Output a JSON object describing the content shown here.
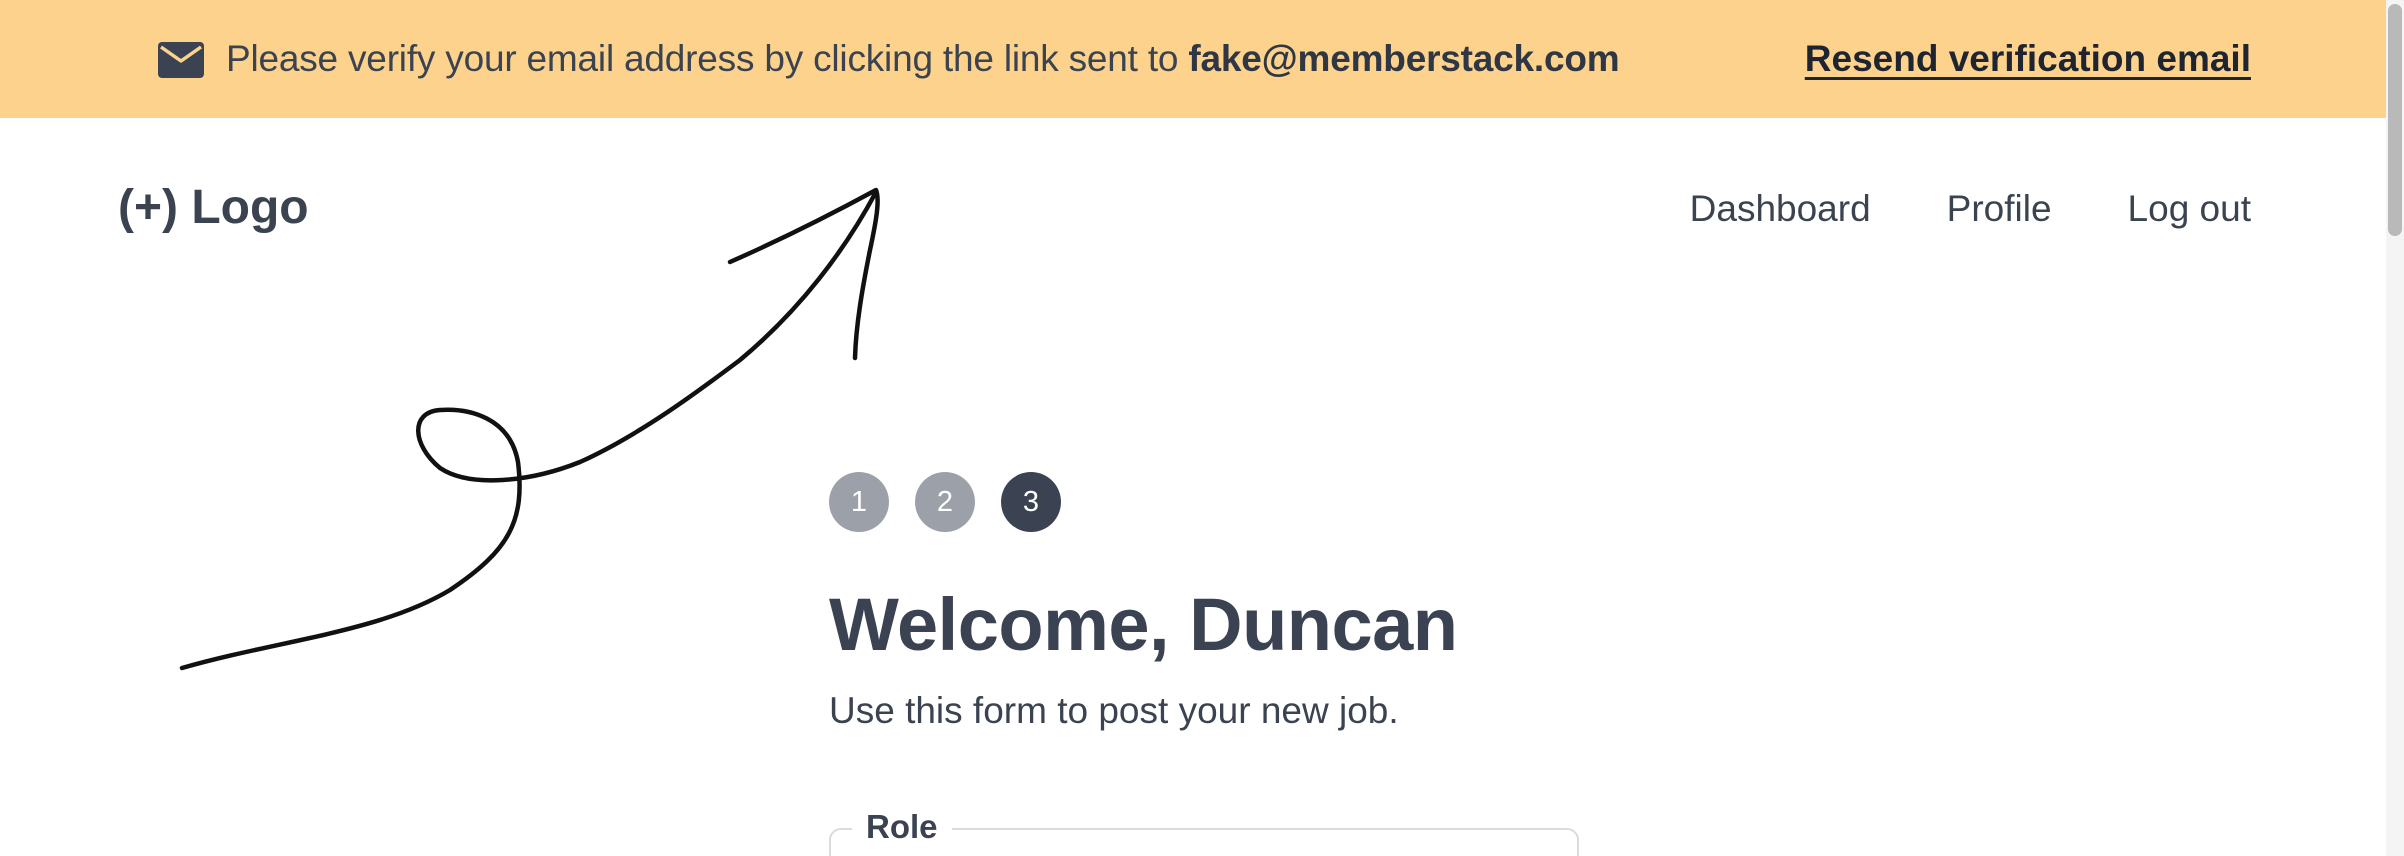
{
  "banner": {
    "icon": "mail-icon",
    "message_prefix": "Please verify your email address by clicking the link sent to",
    "email": "fake@memberstack.com",
    "resend_label": "Resend verification email",
    "background": "#fdd28d"
  },
  "nav": {
    "logo": "(+) Logo",
    "links": [
      {
        "label": "Dashboard"
      },
      {
        "label": "Profile"
      },
      {
        "label": "Log out"
      }
    ]
  },
  "steps": {
    "items": [
      "1",
      "2",
      "3"
    ],
    "active_index": 2
  },
  "main": {
    "title": "Welcome, Duncan",
    "subtitle": "Use this form to post your new job."
  },
  "form": {
    "role_label": "Role"
  },
  "annotation": {
    "icon": "hand-drawn-arrow-icon"
  }
}
